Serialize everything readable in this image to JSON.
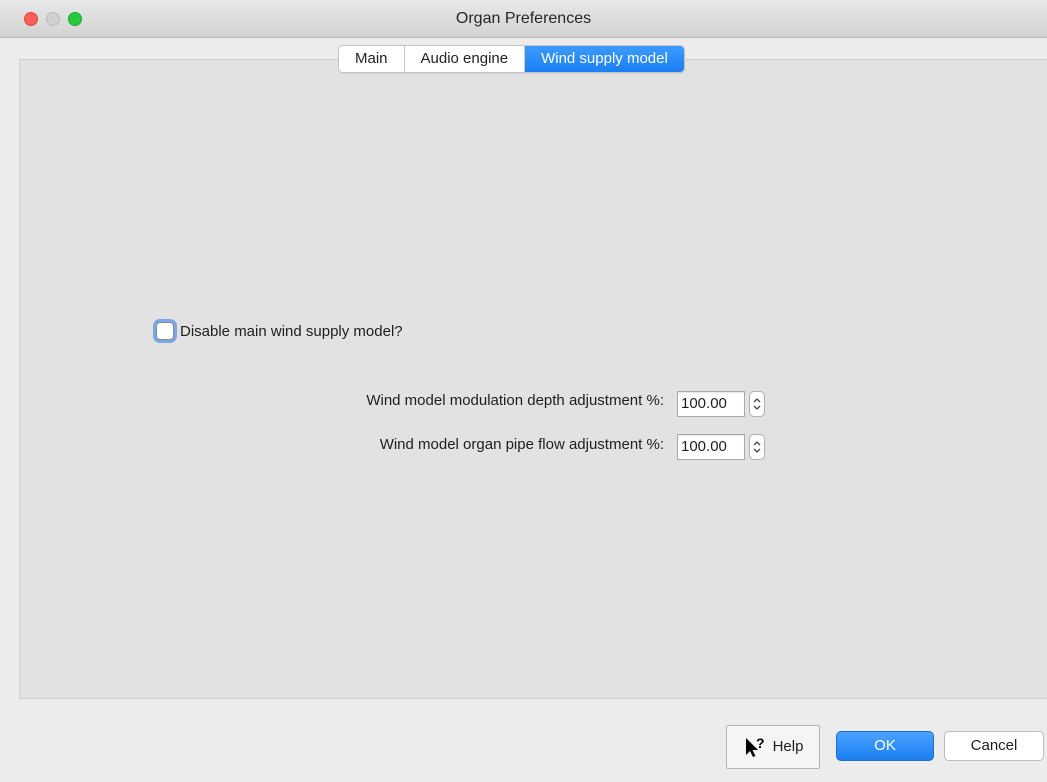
{
  "window": {
    "title": "Organ Preferences"
  },
  "tabs": [
    {
      "label": "Main",
      "active": false
    },
    {
      "label": "Audio engine",
      "active": false
    },
    {
      "label": "Wind supply model",
      "active": true
    }
  ],
  "wind": {
    "disable_checkbox": {
      "label": "Disable main wind supply model?",
      "checked": false
    },
    "modulation": {
      "label": "Wind model modulation depth adjustment %:",
      "value": "100.00"
    },
    "pipe_flow": {
      "label": "Wind model organ pipe flow adjustment %:",
      "value": "100.00"
    }
  },
  "buttons": {
    "help": "Help",
    "help_icon": "context-help-arrow-icon",
    "ok": "OK",
    "cancel": "Cancel"
  },
  "colors": {
    "accent": "#1a7ff4",
    "close": "#fc5f57",
    "zoom": "#28c840"
  }
}
